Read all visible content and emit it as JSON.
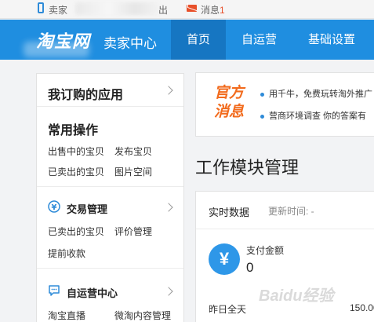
{
  "topbar": {
    "seller_link": "卖家",
    "logout_link": "出",
    "messages_label": "消息",
    "messages_count": "1"
  },
  "header": {
    "logo": "淘宝网",
    "title": "卖家中心",
    "nav": [
      {
        "label": "首页",
        "active": true
      },
      {
        "label": "自运营",
        "active": false
      },
      {
        "label": "基础设置",
        "active": false
      }
    ]
  },
  "sidebar": {
    "subscribed_apps": "我订购的应用",
    "common_ops_title": "常用操作",
    "common_ops": [
      "出售中的宝贝",
      "发布宝贝",
      "已卖出的宝贝",
      "图片空间"
    ],
    "trade": {
      "title": "交易管理",
      "links": [
        "已卖出的宝贝",
        "评价管理",
        "提前收款"
      ]
    },
    "self_op": {
      "title": "自运营中心",
      "links": [
        "淘宝直播",
        "微淘内容管理"
      ]
    }
  },
  "notice": {
    "badge_line1": "官方",
    "badge_line2": "消息",
    "items": [
      "用千牛，免费玩转淘外推广",
      "营商环境调查 你的答案有"
    ]
  },
  "module": {
    "title": "工作模块管理",
    "tab": "实时数据",
    "update_label": "更新时间: -",
    "pay_icon": "¥",
    "pay_label": "支付金额",
    "pay_value": "0",
    "yesterday_label": "昨日全天",
    "yesterday_value": "150.00"
  },
  "watermark": "Baidu经验",
  "colors": {
    "header_blue": "#1f8ee0",
    "nav_active": "#1676c2",
    "accent_orange": "#f26b1d",
    "message_red": "#e8502a"
  }
}
